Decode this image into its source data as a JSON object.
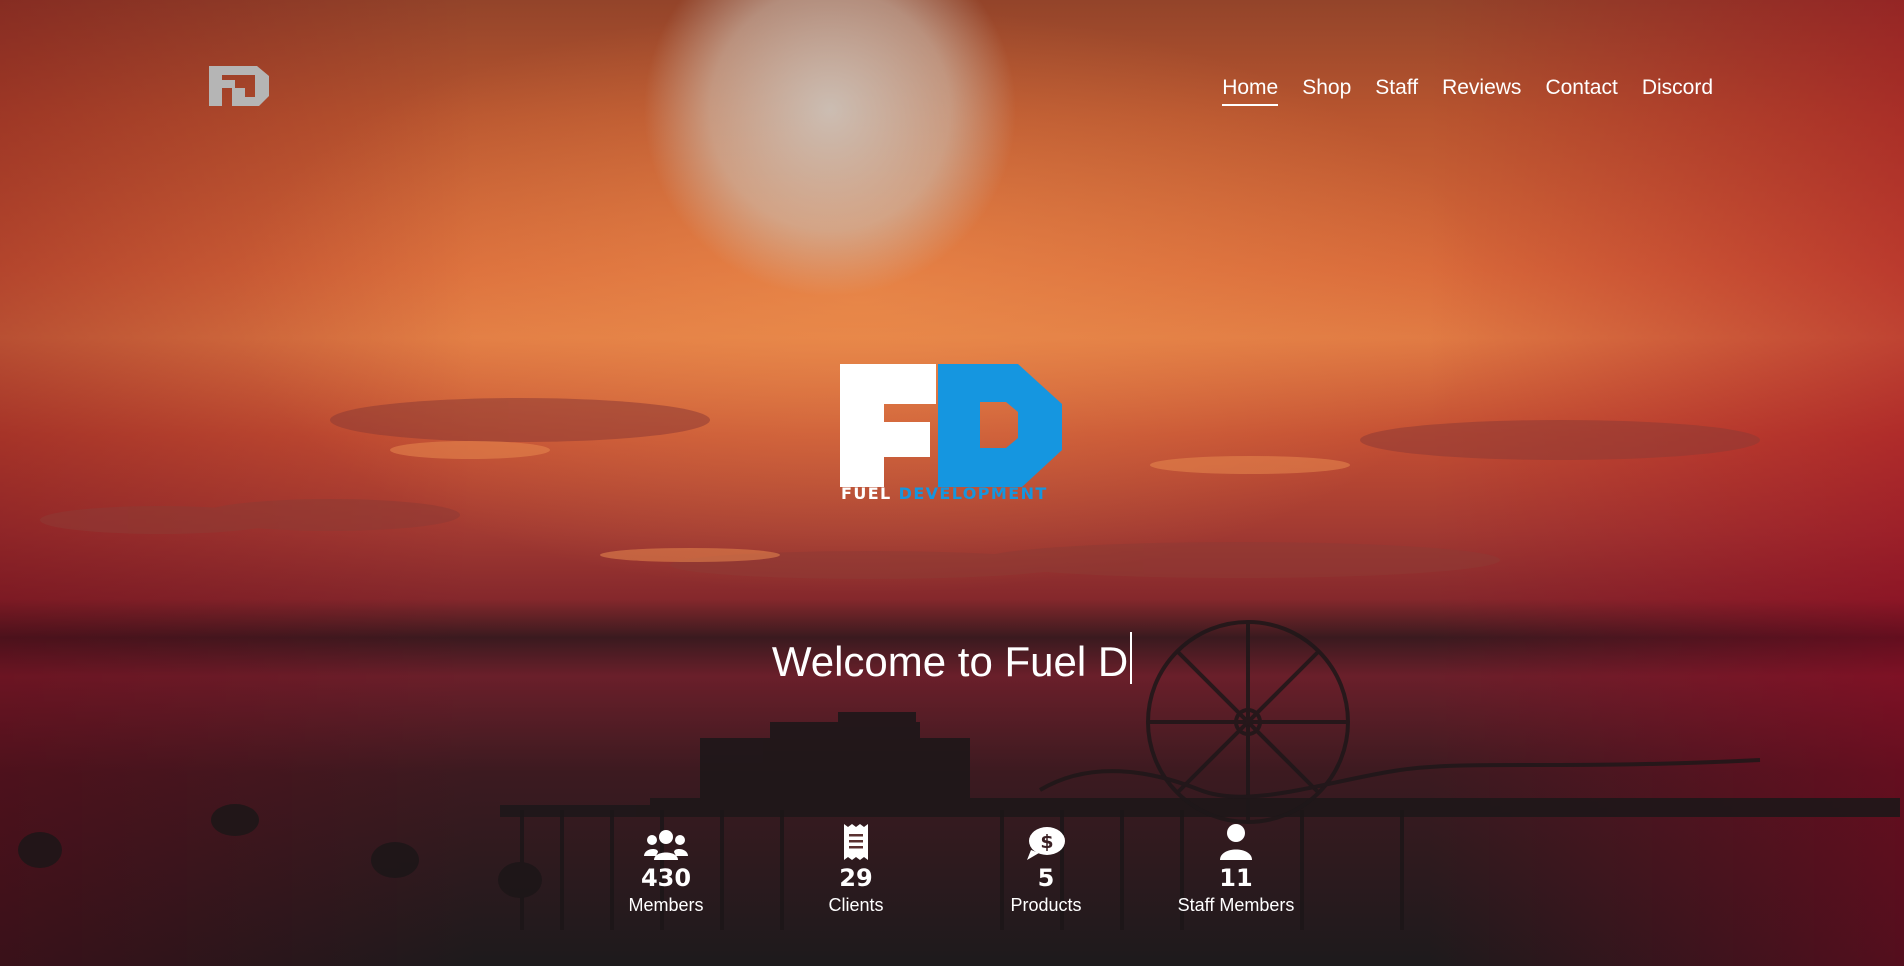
{
  "nav": {
    "items": [
      {
        "label": "Home",
        "active": true
      },
      {
        "label": "Shop",
        "active": false
      },
      {
        "label": "Staff",
        "active": false
      },
      {
        "label": "Reviews",
        "active": false
      },
      {
        "label": "Contact",
        "active": false
      },
      {
        "label": "Discord",
        "active": false
      }
    ]
  },
  "brand": {
    "logo_text": "FUEL DEVELOPMENT",
    "word1": "FUEL",
    "word2": "DEVELOPMENT",
    "accent_color": "#1596e0"
  },
  "hero": {
    "welcome_text": "Welcome to Fuel D"
  },
  "stats": [
    {
      "icon": "users-icon",
      "value": "430",
      "label": "Members"
    },
    {
      "icon": "receipt-icon",
      "value": "29",
      "label": "Clients"
    },
    {
      "icon": "dollar-chat-icon",
      "value": "5",
      "label": "Products"
    },
    {
      "icon": "user-icon",
      "value": "11",
      "label": "Staff Members"
    }
  ]
}
